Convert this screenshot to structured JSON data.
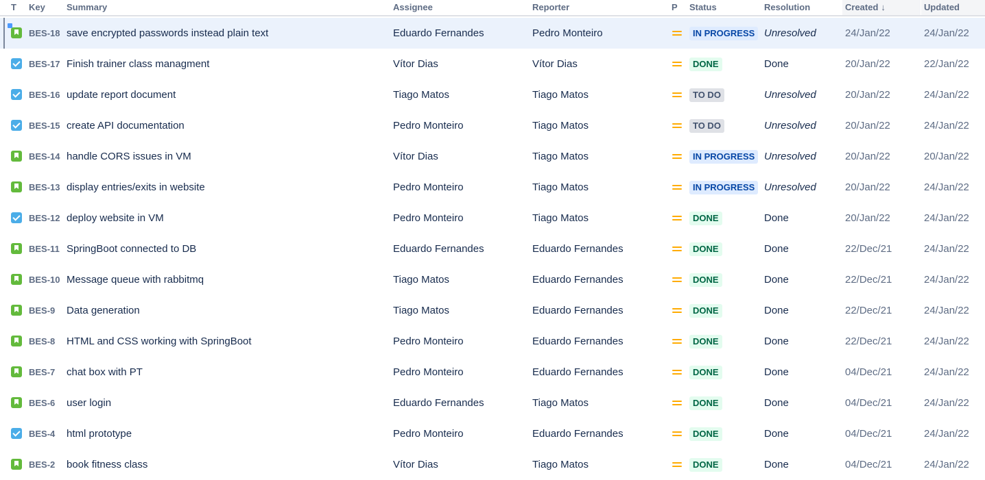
{
  "columns": {
    "type": "T",
    "key": "Key",
    "summary": "Summary",
    "assignee": "Assignee",
    "reporter": "Reporter",
    "priority": "P",
    "status": "Status",
    "resolution": "Resolution",
    "created": "Created",
    "updated": "Updated"
  },
  "sort": {
    "column": "created",
    "direction_icon": "↓"
  },
  "colors": {
    "story": "#63ba3c",
    "task": "#4bade8",
    "priority_medium": "#ffab00",
    "in_progress_bg": "#deebff",
    "done_bg": "#e3fcef",
    "todo_bg": "#dfe1e6",
    "selected_row_bg": "#ebf2fc"
  },
  "issues": [
    {
      "type": "story",
      "type_icon": "story-icon",
      "key": "BES-18",
      "summary": "save encrypted passwords instead plain text",
      "assignee": "Eduardo Fernandes",
      "reporter": "Pedro Monteiro",
      "priority": "medium-priority-icon",
      "status": "IN PROGRESS",
      "status_class": "inprogress",
      "resolution": "Unresolved",
      "created": "24/Jan/22",
      "updated": "24/Jan/22",
      "selected": true
    },
    {
      "type": "task",
      "type_icon": "task-icon",
      "key": "BES-17",
      "summary": "Finish trainer class managment",
      "assignee": "Vítor Dias",
      "reporter": "Vítor Dias",
      "priority": "medium-priority-icon",
      "status": "DONE",
      "status_class": "done",
      "resolution": "Done",
      "created": "20/Jan/22",
      "updated": "22/Jan/22",
      "selected": false
    },
    {
      "type": "task",
      "type_icon": "task-icon",
      "key": "BES-16",
      "summary": "update report document",
      "assignee": "Tiago Matos",
      "reporter": "Tiago Matos",
      "priority": "medium-priority-icon",
      "status": "TO DO",
      "status_class": "todo",
      "resolution": "Unresolved",
      "created": "20/Jan/22",
      "updated": "24/Jan/22",
      "selected": false
    },
    {
      "type": "task",
      "type_icon": "task-icon",
      "key": "BES-15",
      "summary": "create API documentation",
      "assignee": "Pedro Monteiro",
      "reporter": "Tiago Matos",
      "priority": "medium-priority-icon",
      "status": "TO DO",
      "status_class": "todo",
      "resolution": "Unresolved",
      "created": "20/Jan/22",
      "updated": "24/Jan/22",
      "selected": false
    },
    {
      "type": "story",
      "type_icon": "story-icon",
      "key": "BES-14",
      "summary": "handle CORS issues in VM",
      "assignee": "Vítor Dias",
      "reporter": "Tiago Matos",
      "priority": "medium-priority-icon",
      "status": "IN PROGRESS",
      "status_class": "inprogress",
      "resolution": "Unresolved",
      "created": "20/Jan/22",
      "updated": "20/Jan/22",
      "selected": false
    },
    {
      "type": "story",
      "type_icon": "story-icon",
      "key": "BES-13",
      "summary": "display entries/exits in website",
      "assignee": "Pedro Monteiro",
      "reporter": "Tiago Matos",
      "priority": "medium-priority-icon",
      "status": "IN PROGRESS",
      "status_class": "inprogress",
      "resolution": "Unresolved",
      "created": "20/Jan/22",
      "updated": "24/Jan/22",
      "selected": false
    },
    {
      "type": "task",
      "type_icon": "task-icon",
      "key": "BES-12",
      "summary": "deploy website in VM",
      "assignee": "Pedro Monteiro",
      "reporter": "Tiago Matos",
      "priority": "medium-priority-icon",
      "status": "DONE",
      "status_class": "done",
      "resolution": "Done",
      "created": "20/Jan/22",
      "updated": "24/Jan/22",
      "selected": false
    },
    {
      "type": "story",
      "type_icon": "story-icon",
      "key": "BES-11",
      "summary": "SpringBoot connected to DB",
      "assignee": "Eduardo Fernandes",
      "reporter": "Eduardo Fernandes",
      "priority": "medium-priority-icon",
      "status": "DONE",
      "status_class": "done",
      "resolution": "Done",
      "created": "22/Dec/21",
      "updated": "24/Jan/22",
      "selected": false
    },
    {
      "type": "story",
      "type_icon": "story-icon",
      "key": "BES-10",
      "summary": "Message queue with rabbitmq",
      "assignee": "Tiago Matos",
      "reporter": "Eduardo Fernandes",
      "priority": "medium-priority-icon",
      "status": "DONE",
      "status_class": "done",
      "resolution": "Done",
      "created": "22/Dec/21",
      "updated": "24/Jan/22",
      "selected": false
    },
    {
      "type": "story",
      "type_icon": "story-icon",
      "key": "BES-9",
      "summary": "Data generation",
      "assignee": "Tiago Matos",
      "reporter": "Eduardo Fernandes",
      "priority": "medium-priority-icon",
      "status": "DONE",
      "status_class": "done",
      "resolution": "Done",
      "created": "22/Dec/21",
      "updated": "24/Jan/22",
      "selected": false
    },
    {
      "type": "story",
      "type_icon": "story-icon",
      "key": "BES-8",
      "summary": "HTML and CSS working with SpringBoot",
      "assignee": "Pedro Monteiro",
      "reporter": "Eduardo Fernandes",
      "priority": "medium-priority-icon",
      "status": "DONE",
      "status_class": "done",
      "resolution": "Done",
      "created": "22/Dec/21",
      "updated": "24/Jan/22",
      "selected": false
    },
    {
      "type": "story",
      "type_icon": "story-icon",
      "key": "BES-7",
      "summary": "chat box with PT",
      "assignee": "Pedro Monteiro",
      "reporter": "Eduardo Fernandes",
      "priority": "medium-priority-icon",
      "status": "DONE",
      "status_class": "done",
      "resolution": "Done",
      "created": "04/Dec/21",
      "updated": "24/Jan/22",
      "selected": false
    },
    {
      "type": "story",
      "type_icon": "story-icon",
      "key": "BES-6",
      "summary": "user login",
      "assignee": "Eduardo Fernandes",
      "reporter": "Tiago Matos",
      "priority": "medium-priority-icon",
      "status": "DONE",
      "status_class": "done",
      "resolution": "Done",
      "created": "04/Dec/21",
      "updated": "24/Jan/22",
      "selected": false
    },
    {
      "type": "task",
      "type_icon": "task-icon",
      "key": "BES-4",
      "summary": "html prototype",
      "assignee": "Pedro Monteiro",
      "reporter": "Eduardo Fernandes",
      "priority": "medium-priority-icon",
      "status": "DONE",
      "status_class": "done",
      "resolution": "Done",
      "created": "04/Dec/21",
      "updated": "24/Jan/22",
      "selected": false
    },
    {
      "type": "story",
      "type_icon": "story-icon",
      "key": "BES-2",
      "summary": "book fitness class",
      "assignee": "Vítor Dias",
      "reporter": "Tiago Matos",
      "priority": "medium-priority-icon",
      "status": "DONE",
      "status_class": "done",
      "resolution": "Done",
      "created": "04/Dec/21",
      "updated": "24/Jan/22",
      "selected": false
    }
  ]
}
